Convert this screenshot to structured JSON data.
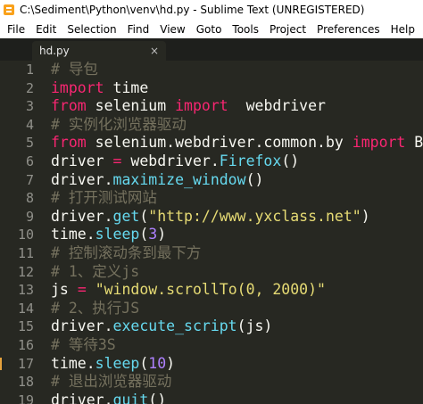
{
  "window": {
    "title": "C:\\Sediment\\Python\\venv\\hd.py - Sublime Text (UNREGISTERED)"
  },
  "menu": [
    "File",
    "Edit",
    "Selection",
    "Find",
    "View",
    "Goto",
    "Tools",
    "Project",
    "Preferences",
    "Help"
  ],
  "tab": {
    "label": "hd.py",
    "close": "×"
  },
  "colors": {
    "background": "#272822",
    "comment": "#75715e",
    "keyword": "#f92672",
    "function": "#66d9ef",
    "string": "#e6db74",
    "number": "#ae81ff",
    "text": "#f8f8f2"
  },
  "lines": [
    {
      "num": "1",
      "tokens": [
        {
          "t": "# 导包",
          "c": "cm"
        }
      ]
    },
    {
      "num": "2",
      "tokens": [
        {
          "t": "import",
          "c": "kw"
        },
        {
          "t": " time",
          "c": "tx"
        }
      ]
    },
    {
      "num": "3",
      "tokens": [
        {
          "t": "from",
          "c": "kw"
        },
        {
          "t": " selenium ",
          "c": "tx"
        },
        {
          "t": "import",
          "c": "kw"
        },
        {
          "t": "  webdriver",
          "c": "tx"
        }
      ]
    },
    {
      "num": "4",
      "tokens": [
        {
          "t": "# 实例化浏览器驱动",
          "c": "cm"
        }
      ]
    },
    {
      "num": "5",
      "tokens": [
        {
          "t": "from",
          "c": "kw"
        },
        {
          "t": " selenium.webdriver.common.by ",
          "c": "tx"
        },
        {
          "t": "import",
          "c": "kw"
        },
        {
          "t": " By",
          "c": "tx"
        }
      ]
    },
    {
      "num": "6",
      "tokens": [
        {
          "t": "driver ",
          "c": "tx"
        },
        {
          "t": "=",
          "c": "op"
        },
        {
          "t": " webdriver.",
          "c": "tx"
        },
        {
          "t": "Firefox",
          "c": "fn"
        },
        {
          "t": "()",
          "c": "tx"
        }
      ]
    },
    {
      "num": "7",
      "tokens": [
        {
          "t": "driver.",
          "c": "tx"
        },
        {
          "t": "maximize_window",
          "c": "fn"
        },
        {
          "t": "()",
          "c": "tx"
        }
      ]
    },
    {
      "num": "8",
      "tokens": [
        {
          "t": "# 打开测试网站",
          "c": "cm"
        }
      ]
    },
    {
      "num": "9",
      "tokens": [
        {
          "t": "driver.",
          "c": "tx"
        },
        {
          "t": "get",
          "c": "fn"
        },
        {
          "t": "(",
          "c": "tx"
        },
        {
          "t": "\"http://www.yxclass.net\"",
          "c": "st"
        },
        {
          "t": ")",
          "c": "tx"
        }
      ]
    },
    {
      "num": "10",
      "tokens": [
        {
          "t": "time.",
          "c": "tx"
        },
        {
          "t": "sleep",
          "c": "fn"
        },
        {
          "t": "(",
          "c": "tx"
        },
        {
          "t": "3",
          "c": "nm"
        },
        {
          "t": ")",
          "c": "tx"
        }
      ]
    },
    {
      "num": "11",
      "tokens": [
        {
          "t": "# 控制滚动条到最下方",
          "c": "cm"
        }
      ]
    },
    {
      "num": "12",
      "tokens": [
        {
          "t": "# 1、定义js",
          "c": "cm"
        }
      ]
    },
    {
      "num": "13",
      "tokens": [
        {
          "t": "js ",
          "c": "tx"
        },
        {
          "t": "=",
          "c": "op"
        },
        {
          "t": " ",
          "c": "tx"
        },
        {
          "t": "\"window.scrollTo(0, 2000)\"",
          "c": "st"
        }
      ]
    },
    {
      "num": "14",
      "tokens": [
        {
          "t": "# 2、执行JS",
          "c": "cm"
        }
      ]
    },
    {
      "num": "15",
      "tokens": [
        {
          "t": "driver.",
          "c": "tx"
        },
        {
          "t": "execute_script",
          "c": "fn"
        },
        {
          "t": "(js)",
          "c": "tx"
        }
      ]
    },
    {
      "num": "16",
      "tokens": [
        {
          "t": "# 等待3S",
          "c": "cm"
        }
      ]
    },
    {
      "num": "17",
      "modified": true,
      "tokens": [
        {
          "t": "time.",
          "c": "tx"
        },
        {
          "t": "sleep",
          "c": "fn"
        },
        {
          "t": "(",
          "c": "tx"
        },
        {
          "t": "10",
          "c": "nm"
        },
        {
          "t": ")",
          "c": "tx"
        }
      ]
    },
    {
      "num": "18",
      "tokens": [
        {
          "t": "# 退出浏览器驱动",
          "c": "cm"
        }
      ]
    },
    {
      "num": "19",
      "tokens": [
        {
          "t": "driver.",
          "c": "tx"
        },
        {
          "t": "quit",
          "c": "fn"
        },
        {
          "t": "()",
          "c": "tx"
        }
      ]
    }
  ]
}
